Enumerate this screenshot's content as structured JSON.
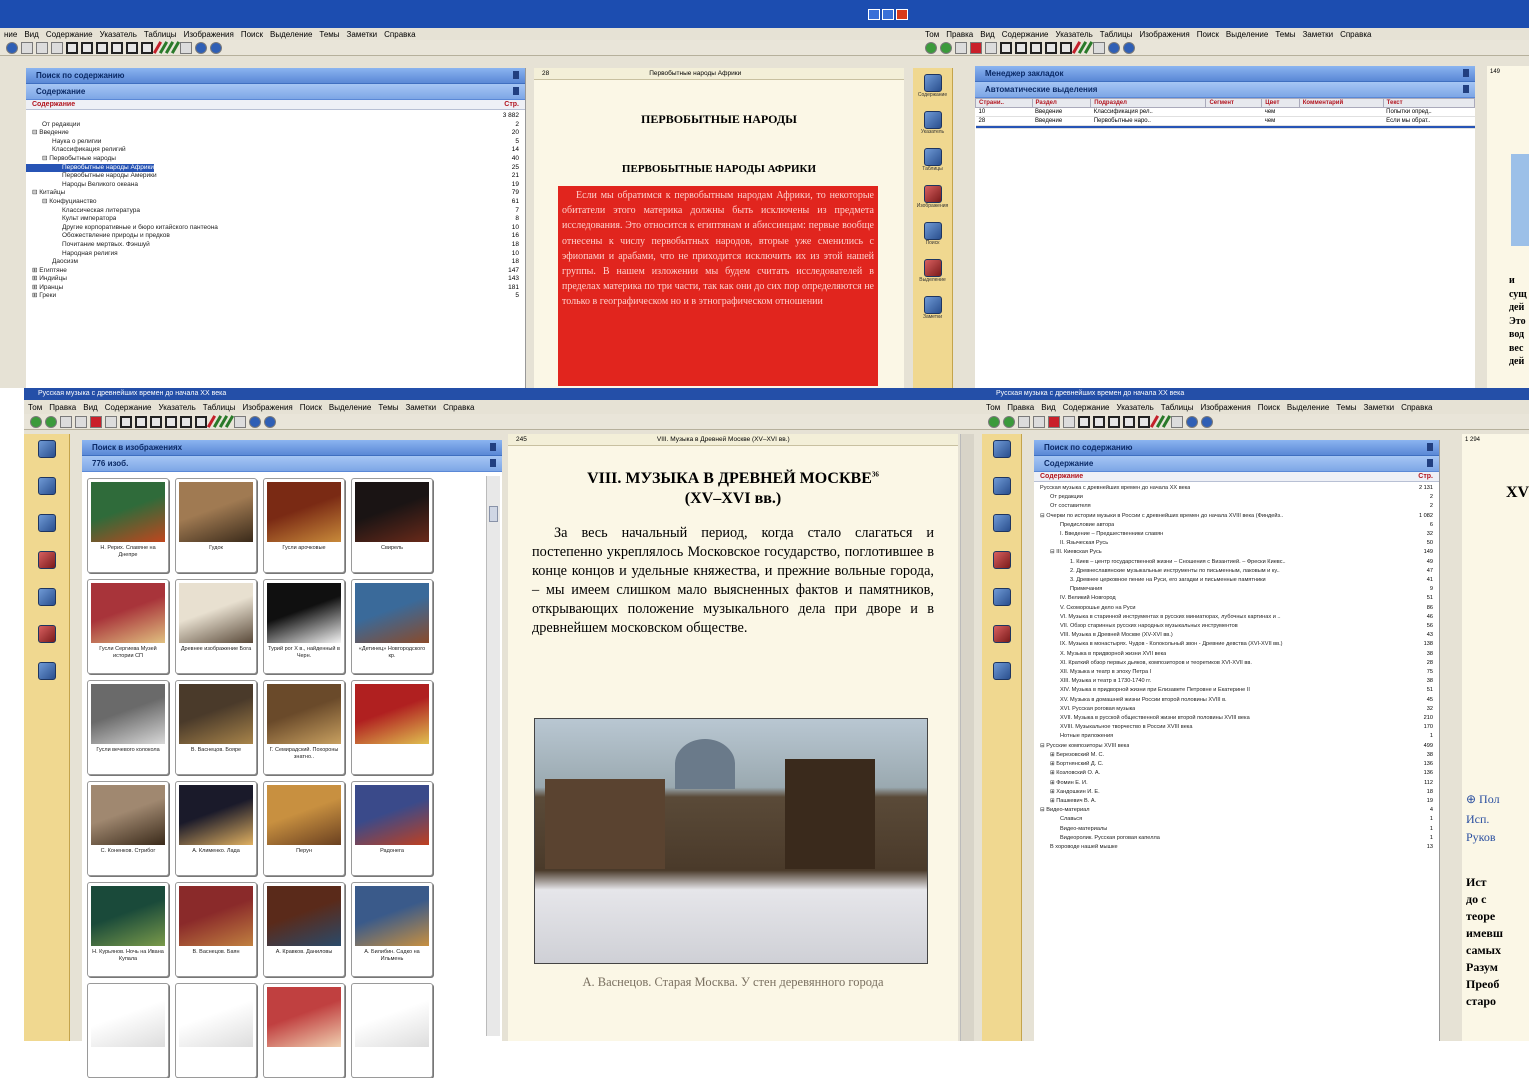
{
  "top_left": {
    "menu": [
      "ние",
      "Вид",
      "Содержание",
      "Указатель",
      "Таблицы",
      "Изображения",
      "Поиск",
      "Выделение",
      "Темы",
      "Заметки",
      "Справка"
    ],
    "panel_title": "Поиск по содержанию",
    "panel_sub": "Содержание",
    "tree_header": {
      "col": "Содержание",
      "pages": "Стр."
    },
    "tree": [
      {
        "t": "",
        "p": "3 882",
        "i": 0
      },
      {
        "t": "От редакции",
        "p": "2",
        "i": 1
      },
      {
        "t": "⊟ Введение",
        "p": "20",
        "i": 0
      },
      {
        "t": "Наука о религии",
        "p": "5",
        "i": 2
      },
      {
        "t": "Классификация религий",
        "p": "14",
        "i": 2
      },
      {
        "t": "⊟ Первобытные народы",
        "p": "40",
        "i": 1
      },
      {
        "t": "Первобытные народы Африки",
        "p": "25",
        "i": 3,
        "sel": true
      },
      {
        "t": "Первобытные народы Америки",
        "p": "21",
        "i": 3
      },
      {
        "t": "Народы Великого океана",
        "p": "19",
        "i": 3
      },
      {
        "t": "⊟ Китайцы",
        "p": "79",
        "i": 0
      },
      {
        "t": "⊟ Конфуцианство",
        "p": "61",
        "i": 1
      },
      {
        "t": "Классическая литература",
        "p": "7",
        "i": 3
      },
      {
        "t": "Культ императора",
        "p": "8",
        "i": 3
      },
      {
        "t": "Другие корпоративные и бюро китайского пантеона",
        "p": "10",
        "i": 3
      },
      {
        "t": "Обожествление природы и предков",
        "p": "16",
        "i": 3
      },
      {
        "t": "Почитание мертвых. Фэншуй",
        "p": "18",
        "i": 3
      },
      {
        "t": "Народная религия",
        "p": "10",
        "i": 3
      },
      {
        "t": "Даосизм",
        "p": "18",
        "i": 2
      },
      {
        "t": "⊞ Египтяне",
        "p": "147",
        "i": 0
      },
      {
        "t": "⊞ Индийцы",
        "p": "143",
        "i": 0
      },
      {
        "t": "⊞ Иранцы",
        "p": "181",
        "i": 0
      },
      {
        "t": "⊞ Греки",
        "p": "5",
        "i": 0
      }
    ],
    "doc_page": "28",
    "doc_head": "Первобытные народы Африки",
    "heading1": "ПЕРВОБЫТНЫЕ НАРОДЫ",
    "heading2": "ПЕРВОБЫТНЫЕ НАРОДЫ АФРИКИ",
    "paragraph": "Если мы обратимся к первобытным народам Африки, то некоторые обитатели этого материка должны быть исключены из предмета исследования. Это относится к египтянам и абиссинцам: первые вообще отнесены к числу первобытных народов, вторые уже сменились с эфиопами и арабами, что не приходится исключить их из этой нашей группы. В нашем изложении мы будем считать исследователей в пределах материка по три части, так как они до сих пор определяются не только в географическом но и в этнографическом отношении"
  },
  "top_right": {
    "menu": [
      "Том",
      "Правка",
      "Вид",
      "Содержание",
      "Указатель",
      "Таблицы",
      "Изображения",
      "Поиск",
      "Выделение",
      "Темы",
      "Заметки",
      "Справка"
    ],
    "panel_title": "Менеджер закладок",
    "panel_sub": "Автоматические выделения",
    "columns": [
      "Страни..",
      "Раздел",
      "Подраздел",
      "Сегмент",
      "Цвет",
      "Комментарий",
      "Текст"
    ],
    "rows": [
      {
        "c": [
          "10",
          "Введение",
          "Классификация рел..",
          "",
          "чем",
          "",
          "Попытки опред.."
        ]
      },
      {
        "c": [
          "28",
          "Введение",
          "Первобытные наро..",
          "",
          "чем",
          "",
          "Если мы обрат.."
        ]
      },
      {
        "c": [
          "",
          "",
          "",
          "",
          "",
          "",
          "",
          ""
        ],
        "sel": true
      }
    ],
    "side_labels": [
      "Содержание",
      "Указатель",
      "Таблицы",
      "Изображения",
      "Поиск",
      "Выделение",
      "Заметки"
    ],
    "page_num": "149",
    "clip_text": [
      "и",
      "сущ",
      "дей",
      "Это",
      "вод",
      "вес",
      "дей"
    ]
  },
  "bottom_left": {
    "title": "Русская музыка с древнейших времен до начала XX века",
    "menu": [
      "Том",
      "Правка",
      "Вид",
      "Содержание",
      "Указатель",
      "Таблицы",
      "Изображения",
      "Поиск",
      "Выделение",
      "Темы",
      "Заметки",
      "Справка"
    ],
    "panel_title": "Поиск в изображениях",
    "panel_sub": "776 изоб.",
    "tiles": [
      {
        "cap": "Н. Рерих. Славяне на Днепре",
        "c1": "#2f6b3a",
        "c2": "#c0461e"
      },
      {
        "cap": "Гудок",
        "c1": "#a07a52",
        "c2": "#3a2a1a"
      },
      {
        "cap": "Гусли арочковые",
        "c1": "#7a2a14",
        "c2": "#c88a3a"
      },
      {
        "cap": "Свирель",
        "c1": "#1a1414",
        "c2": "#6a2a1a"
      },
      {
        "cap": "Гусли Сергиева Музей истории СП",
        "c1": "#a8343a",
        "c2": "#e0c080"
      },
      {
        "cap": "Древнее изображение Бога",
        "c1": "#e8e0d0",
        "c2": "#5a4a3a"
      },
      {
        "cap": "Турий рог X в., найденный в Черн.",
        "c1": "#101010",
        "c2": "#f4f4f4"
      },
      {
        "cap": "«Детинец» Новгородского кр.",
        "c1": "#3a6a9a",
        "c2": "#8a4a2a"
      },
      {
        "cap": "Гусли вечевого колокола",
        "c1": "#6a6a6a",
        "c2": "#d8d8d8"
      },
      {
        "cap": "В. Васнецов. Бояре",
        "c1": "#4a3a2a",
        "c2": "#a8844a"
      },
      {
        "cap": "Г. Семирадский. Похороны знатно..",
        "c1": "#6a4a2a",
        "c2": "#c8a060"
      },
      {
        "cap": "",
        "c1": "#b02020",
        "c2": "#e0c050"
      },
      {
        "cap": "С. Коненков. Стрибог",
        "c1": "#a08870",
        "c2": "#3a2a1a"
      },
      {
        "cap": "А. Клименко. Лада",
        "c1": "#1a1a2a",
        "c2": "#e0b060"
      },
      {
        "cap": "Перун",
        "c1": "#c89040",
        "c2": "#6a4020"
      },
      {
        "cap": "Радонега",
        "c1": "#3a4a8a",
        "c2": "#c04020"
      },
      {
        "cap": "Н. Курьянов. Ночь на Ивана Купала",
        "c1": "#1a4a3a",
        "c2": "#7a9a4a"
      },
      {
        "cap": "В. Васнецов. Баян",
        "c1": "#8a2a2a",
        "c2": "#c08040"
      },
      {
        "cap": "А. Кравков. Даниловы",
        "c1": "#5a2a1a",
        "c2": "#2a4a6a"
      },
      {
        "cap": "А. Билибин. Садко на Ильмень",
        "c1": "#3a5a8a",
        "c2": "#c89040"
      },
      {
        "cap": "",
        "c1": "#ffffff",
        "c2": "#dddddd"
      },
      {
        "cap": "",
        "c1": "#ffffff",
        "c2": "#dddddd"
      },
      {
        "cap": "",
        "c1": "#c04040",
        "c2": "#f0d0b0"
      },
      {
        "cap": "",
        "c1": "#ffffff",
        "c2": "#dddddd"
      }
    ],
    "doc_page": "245",
    "doc_head": "VIII. Музыка в Древней Москве (XV–XVI вв.)",
    "heading": "VIII. МУЗЫКА В ДРЕВНЕЙ МОСКВЕ",
    "heading_sup": "36",
    "heading2": "(XV–XVI вв.)",
    "paragraph": "За весь начальный период, когда стало слагаться и постепенно укреплялось Московское государство, поглотившее в конце концов и удельные княжества, и прежние вольные города, – мы имеем слишком мало выясненных фактов и памятников, открывающих положение музыкального дела при дворе и в древнейшем московском обществе.",
    "caption": "А. Васнецов. Старая Москва. У стен деревянного города"
  },
  "bottom_right": {
    "title": "Русская музыка с древнейших времен до начала XX века",
    "menu": [
      "Том",
      "Правка",
      "Вид",
      "Содержание",
      "Указатель",
      "Таблицы",
      "Изображения",
      "Поиск",
      "Выделение",
      "Темы",
      "Заметки",
      "Справка"
    ],
    "panel_title": "Поиск по содержанию",
    "panel_sub": "Содержание",
    "tree_header": {
      "col": "Содержание",
      "pages": "Стр."
    },
    "tree": [
      {
        "t": "Русская музыка с древнейших времен до начала XX века",
        "p": "2 131",
        "i": 0
      },
      {
        "t": "От редакции",
        "p": "2",
        "i": 1
      },
      {
        "t": "От составителя",
        "p": "2",
        "i": 1
      },
      {
        "t": "⊟ Очерки по истории музыки в России с древнейших времен до начала XVIII века (Финдейз..",
        "p": "1 082",
        "i": 0
      },
      {
        "t": "Предисловие автора",
        "p": "6",
        "i": 2
      },
      {
        "t": "I. Введение – Предшественники славян",
        "p": "32",
        "i": 2
      },
      {
        "t": "II. Языческая Русь",
        "p": "50",
        "i": 2
      },
      {
        "t": "⊟ III. Киевская Русь",
        "p": "149",
        "i": 1
      },
      {
        "t": "1. Киев – центр государственной жизни – Сношения с Византией. – Фрески Киевс..",
        "p": "49",
        "i": 3
      },
      {
        "t": "2. Древнеславянские музыкальные инструменты по письменным, лаковым и ку..",
        "p": "47",
        "i": 3
      },
      {
        "t": "3. Древнее церковное пение на Руси, его загадки и письменные памятники",
        "p": "41",
        "i": 3
      },
      {
        "t": "Примечания",
        "p": "9",
        "i": 3
      },
      {
        "t": "IV. Великий Новгород",
        "p": "51",
        "i": 2
      },
      {
        "t": "V. Скоморошье дело на Руси",
        "p": "86",
        "i": 2
      },
      {
        "t": "VI. Музыка в старинной инструментах в русских миниатюрах, лубочных картинах и ..",
        "p": "46",
        "i": 2
      },
      {
        "t": "VII. Обзор старинных русских народных музыкальных инструментов",
        "p": "56",
        "i": 2
      },
      {
        "t": "VIII. Музыка в Древней Москве (XV-XVI вв.)",
        "p": "43",
        "i": 2
      },
      {
        "t": "IX. Музыка в монастырях. Чудов - Колокольный звон - Древние девства (XVI-XVII вв.)",
        "p": "138",
        "i": 2
      },
      {
        "t": "X. Музыка в придворной жизни XVII века",
        "p": "38",
        "i": 2
      },
      {
        "t": "XI. Краткий обзор первых дьяков, композиторов и теоретиков XVI-XVII вв.",
        "p": "28",
        "i": 2
      },
      {
        "t": "XII. Музыка и театр в эпоху Петра I",
        "p": "75",
        "i": 2
      },
      {
        "t": "XIII. Музыка и театр в 1730-1740 гг.",
        "p": "38",
        "i": 2
      },
      {
        "t": "XIV. Музыка в придворной жизни при Елизавете Петровне и Екатерине II",
        "p": "51",
        "i": 2
      },
      {
        "t": "XV. Музыка в домашней жизни России второй половины XVIII в.",
        "p": "45",
        "i": 2
      },
      {
        "t": "XVI. Русская роговая музыка",
        "p": "32",
        "i": 2
      },
      {
        "t": "XVII. Музыка в русской общественной жизни второй половины XVIII века",
        "p": "210",
        "i": 2
      },
      {
        "t": "XVIII. Музыкальное творчество в России XVIII века",
        "p": "170",
        "i": 2
      },
      {
        "t": "Нотные приложения",
        "p": "1",
        "i": 2
      },
      {
        "t": "⊟ Русские композиторы XVIII века",
        "p": "499",
        "i": 0
      },
      {
        "t": "⊞ Березовский М. С.",
        "p": "38",
        "i": 1
      },
      {
        "t": "⊞ Бортнянский Д. С.",
        "p": "136",
        "i": 1
      },
      {
        "t": "⊞ Козловский О. А.",
        "p": "136",
        "i": 1
      },
      {
        "t": "⊞ Фомин Е. И.",
        "p": "112",
        "i": 1
      },
      {
        "t": "⊞ Хандошкин И. Е.",
        "p": "18",
        "i": 1
      },
      {
        "t": "⊞ Пашкевич В. А.",
        "p": "19",
        "i": 1
      },
      {
        "t": "⊟ Видео-материал",
        "p": "4",
        "i": 0
      },
      {
        "t": "Славься",
        "p": "1",
        "i": 2
      },
      {
        "t": "Видео-материалы",
        "p": "1",
        "i": 2
      },
      {
        "t": "Видеоролик. Русская роговая капелла",
        "p": "1",
        "i": 2
      },
      {
        "t": "В хороводе нашей мышке",
        "p": "13",
        "i": 1
      }
    ],
    "page_num": "1 294",
    "clip_heading": "XV",
    "clip_link": "⊕ Пол",
    "clip_lines": [
      "Исп.",
      "Руков"
    ],
    "clip_para": [
      "Ист",
      "до с",
      "теоре",
      "имевш",
      "самых",
      "Разум",
      "Преоб",
      "старо"
    ]
  }
}
